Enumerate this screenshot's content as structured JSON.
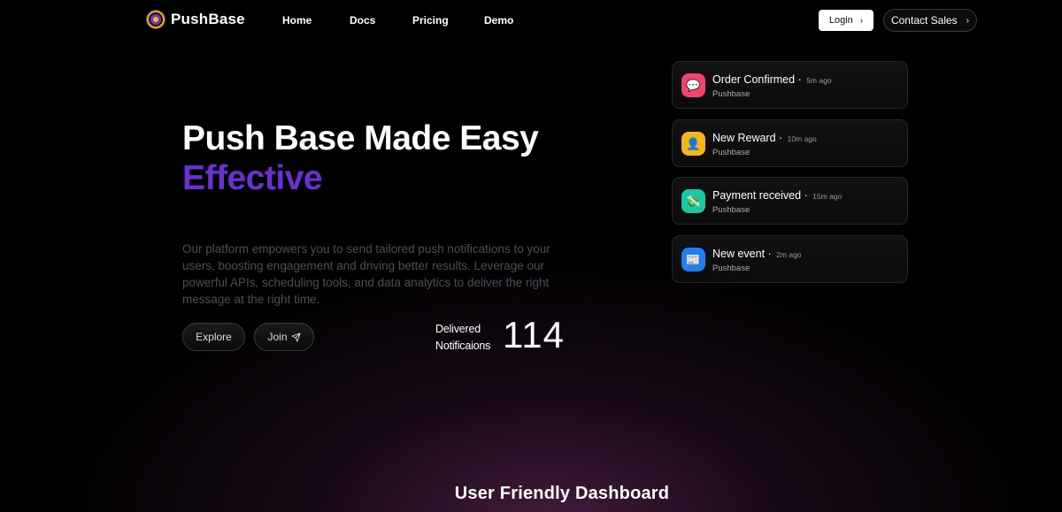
{
  "brand": {
    "name": "PushBase"
  },
  "nav": {
    "links": [
      "Home",
      "Docs",
      "Pricing",
      "Demo"
    ],
    "login_label": "Login",
    "contact_label": "Contact Sales"
  },
  "hero": {
    "title": "Push Base Made Easy",
    "title_accent": "Effective",
    "description": "Our platform empowers you to send tailored push notifications to your users, boosting engagement and driving better results. Leverage our powerful APIs, scheduling tools, and data analytics to deliver the right message at the right time.",
    "explore_label": "Explore",
    "join_label": "Join"
  },
  "stats": {
    "label_line1": "Delivered",
    "label_line2": "Notificaions",
    "count": "114"
  },
  "notifications": [
    {
      "title": "Order Confirmed",
      "time": "5m ago",
      "source": "Pushbase",
      "icon": "chat-bubble-icon",
      "color": "#f0436e",
      "glyph": "💬"
    },
    {
      "title": "New Reward",
      "time": "10m ago",
      "source": "Pushbase",
      "icon": "user-icon",
      "color": "#f5b516",
      "glyph": "👤"
    },
    {
      "title": "Payment received",
      "time": "15m ago",
      "source": "Pushbase",
      "icon": "money-icon",
      "color": "#19c9a4",
      "glyph": "💸"
    },
    {
      "title": "New event",
      "time": "2m ago",
      "source": "Pushbase",
      "icon": "news-icon",
      "color": "#1e7ef2",
      "glyph": "📰"
    }
  ],
  "sections": {
    "dashboard_title": "User Friendly Dashboard"
  },
  "colors": {
    "accent": "#6b2fd4",
    "background": "#000000"
  }
}
